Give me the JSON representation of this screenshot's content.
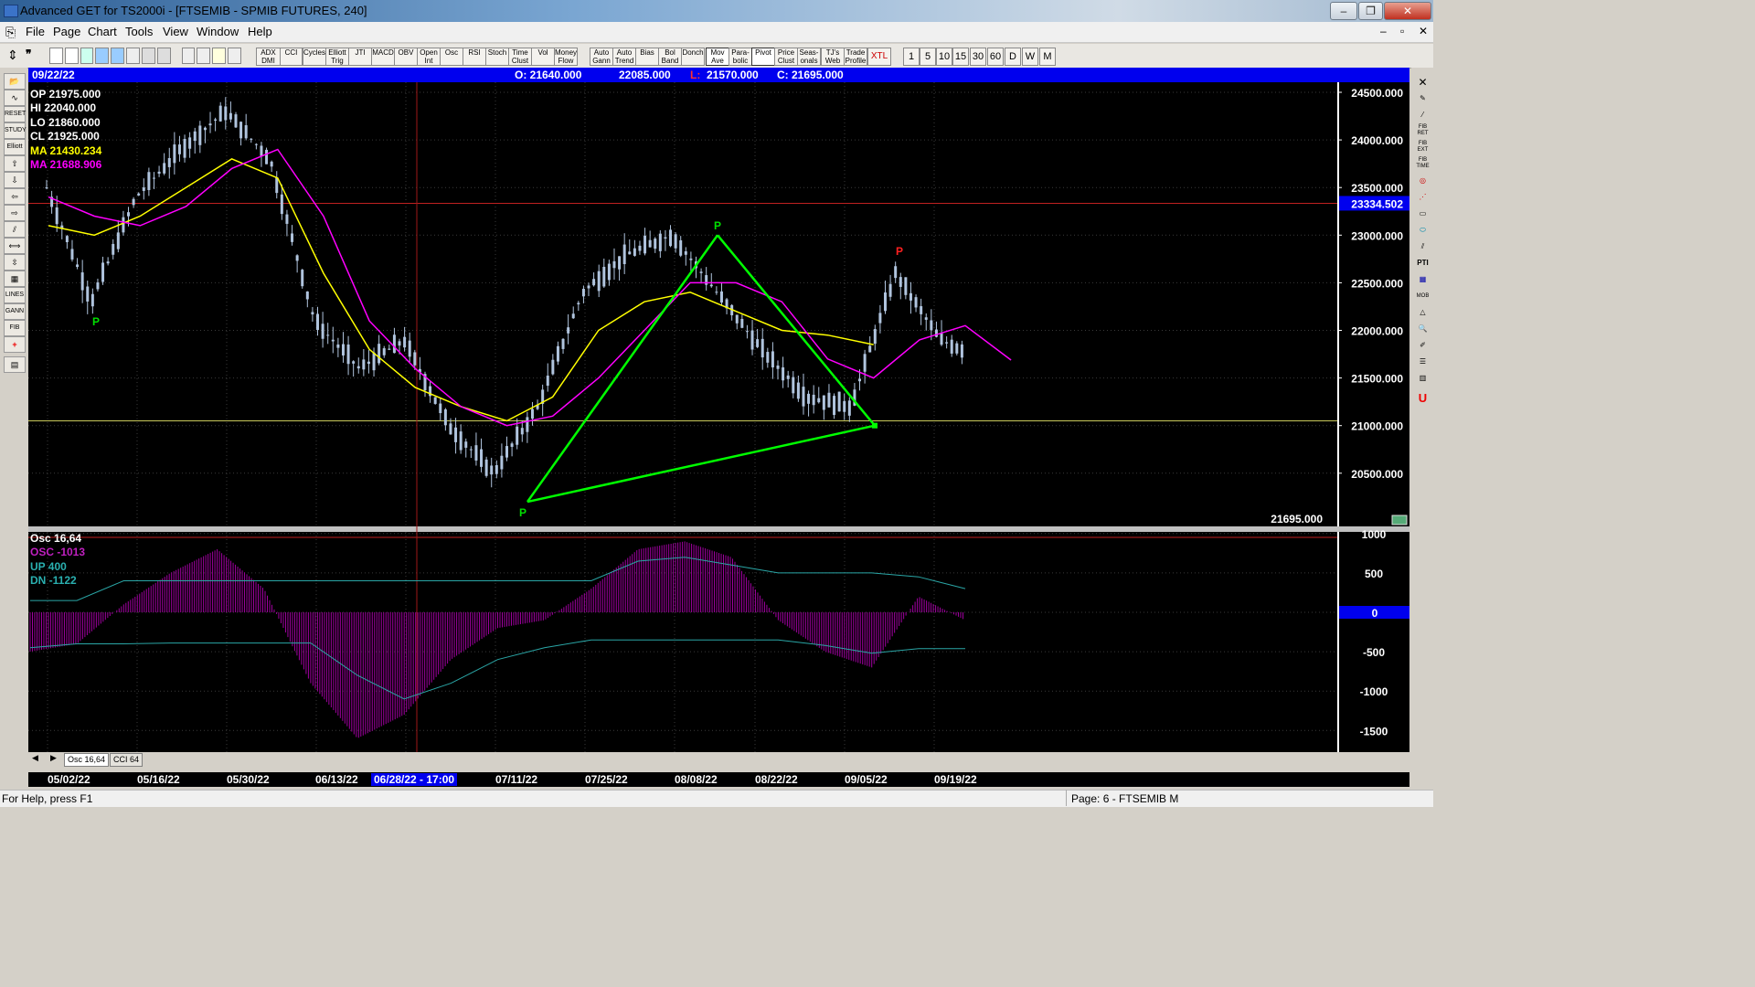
{
  "window": {
    "title": "Advanced GET for TS2000i - [FTSEMIB - SPMIB FUTURES, 240]",
    "minimize": "–",
    "restore": "❐",
    "close": "✕",
    "child_min": "–",
    "child_restore": "▫",
    "child_close": "✕"
  },
  "menu": [
    "File",
    "Page",
    "Chart",
    "Tools",
    "View",
    "Window",
    "Help"
  ],
  "toolbar": {
    "studies": [
      "ADX DMI",
      "CCI",
      "Cycles",
      "Elliott Trig",
      "JTI",
      "MACD",
      "OBV",
      "Open Int",
      "Osc",
      "RSI",
      "Stoch",
      "Time Clust",
      "Vol",
      "Money Flow",
      "Auto Gann",
      "Auto Trend",
      "Bias",
      "Bol Band",
      "Donch",
      "Mov Ave",
      "Para-bolic",
      "Pivot",
      "Price Clust",
      "Seas-onals",
      "TJ's Web",
      "Trade Profile",
      "XTL"
    ],
    "intervals": [
      "1",
      "5",
      "10",
      "15",
      "30",
      "60",
      "D",
      "W",
      "M"
    ]
  },
  "info": {
    "date": "09/22/22",
    "open": "O: 21640.000",
    "high": "22085.000",
    "low_label": "L:",
    "low": "21570.000",
    "close": "C: 21695.000"
  },
  "legend": {
    "op": "OP  21975.000",
    "hi": "HI   22040.000",
    "lo": "LO  21860.000",
    "cl": "CL  21925.000",
    "ma1": "MA  21430.234",
    "ma2": "MA  21688.906"
  },
  "osc_legend": {
    "title": "Osc 16,64",
    "osc": "OSC -1013",
    "up": "UP   400",
    "dn": "DN   -1122"
  },
  "price_axis": [
    "24500.000",
    "24000.000",
    "23500.000",
    "23000.000",
    "22500.000",
    "22000.000",
    "21500.000",
    "21000.000",
    "20500.000"
  ],
  "highlight_price": "23334.502",
  "last_price": "21695.000",
  "osc_axis": [
    "1000",
    "500",
    "0",
    "-500",
    "-1000",
    "-1500"
  ],
  "pivots": [
    "P",
    "P",
    "P",
    "P"
  ],
  "tabs": [
    "Osc 16,64",
    "CCI 64"
  ],
  "dates": [
    "05/02/22",
    "05/16/22",
    "05/30/22",
    "06/13/22",
    "06/28/22 - 17:00",
    "07/11/22",
    "07/25/22",
    "08/08/22",
    "08/22/22",
    "09/05/22",
    "09/19/22"
  ],
  "status": {
    "help": "For Help, press F1",
    "page": "Page: 6 - FTSEMIB M"
  },
  "colors": {
    "background": "#000000",
    "candle": "#b0c4de",
    "ma_yellow": "#ffff00",
    "ma_magenta": "#ff00ff",
    "pattern": "#00ff00",
    "pivot_red": "#ff2020",
    "osc_bar": "#a000a0",
    "band": "#2aa6a6",
    "info_bar": "#0000ee"
  },
  "chart_data": [
    {
      "type": "line",
      "x": [
        "05/02/22",
        "05/09/22",
        "05/16/22",
        "05/23/22",
        "05/30/22",
        "06/06/22",
        "06/13/22",
        "06/20/22",
        "06/28/22",
        "07/04/22",
        "07/11/22",
        "07/18/22",
        "07/25/22",
        "08/01/22",
        "08/08/22",
        "08/15/22",
        "08/22/22",
        "08/29/22",
        "09/05/22",
        "09/12/22",
        "09/19/22",
        "09/22/22"
      ],
      "series": [
        {
          "values": [
            23500,
            22300,
            23400,
            23900,
            24300,
            23800,
            22100,
            21600,
            21900,
            21000,
            20500,
            21200,
            22400,
            22800,
            23000,
            22400,
            21800,
            21300,
            21200,
            22600,
            21900,
            21695
          ]
        },
        {
          "values": [
            23100,
            23000,
            23200,
            23500,
            23800,
            23600,
            22600,
            21800,
            21400,
            21200,
            21050,
            21300,
            22000,
            22300,
            22400,
            22200,
            22000,
            21950,
            21850,
            null,
            null,
            null
          ]
        },
        {
          "values": [
            23400,
            23200,
            23100,
            23300,
            23700,
            23900,
            23200,
            22100,
            21600,
            21200,
            21000,
            21100,
            21500,
            22000,
            22500,
            22500,
            22300,
            21700,
            21500,
            21900,
            22050,
            21688
          ]
        }
      ],
      "ylim": [
        20150,
        24600
      ]
    },
    {
      "type": "bar",
      "categories": [
        "05/02/22",
        "05/09/22",
        "05/16/22",
        "05/23/22",
        "05/30/22",
        "06/06/22",
        "06/13/22",
        "06/20/22",
        "06/28/22",
        "07/04/22",
        "07/11/22",
        "07/18/22",
        "07/25/22",
        "08/01/22",
        "08/08/22",
        "08/15/22",
        "08/22/22",
        "08/29/22",
        "09/05/22",
        "09/12/22",
        "09/19/22"
      ],
      "values": [
        -500,
        -400,
        100,
        500,
        800,
        300,
        -900,
        -1600,
        -1300,
        -600,
        -200,
        -100,
        300,
        800,
        900,
        700,
        -100,
        -500,
        -700,
        200,
        -100
      ],
      "series": [
        {
          "values": [
            -450,
            -400,
            -400,
            -390,
            -390,
            -390,
            -390,
            -800,
            -1100,
            -900,
            -600,
            -450,
            -350,
            -350,
            -350,
            -350,
            -350,
            -420,
            -520,
            -460,
            -460
          ]
        },
        {
          "values": [
            150,
            150,
            400,
            400,
            400,
            400,
            400,
            400,
            400,
            400,
            400,
            400,
            400,
            650,
            700,
            600,
            500,
            500,
            500,
            450,
            300
          ]
        }
      ],
      "ylim": [
        -1800,
        1050
      ]
    }
  ]
}
